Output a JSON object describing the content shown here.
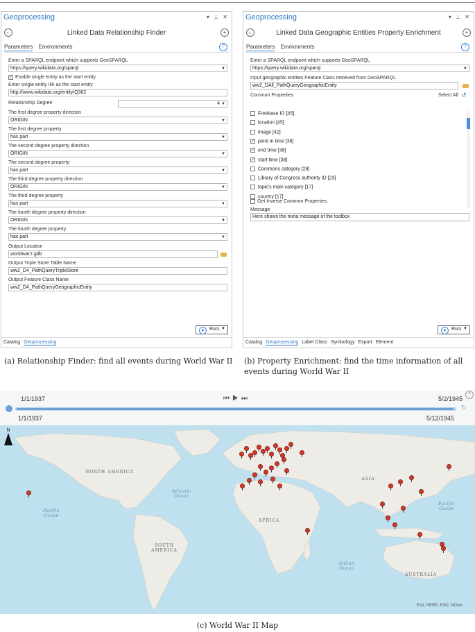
{
  "panelA": {
    "title": "Geoprocessing",
    "win_controls": "▾ ⊥ ✕",
    "tool_name": "Linked Data Relationship Finder",
    "tabs": {
      "parameters": "Parameters",
      "environments": "Environments"
    },
    "fields": {
      "endpoint_label": "Enter a SPARQL endpoint which supports GeoSPARQL",
      "endpoint_value": "https://query.wikidata.org/sparql",
      "enable_single_label": "Enable single entity as the start entity",
      "entity_iri_label": "Enter single entity IRI as the start entity",
      "entity_iri_value": "http://www.wikidata.org/entity/Q362",
      "degree_label": "Relationship Degree",
      "degree_value": "4",
      "d1_dir_label": "The first degree property direction",
      "d1_dir_value": "ORIGIN",
      "d1_prop_label": "The first degree property",
      "d1_prop_value": "has part",
      "d2_dir_label": "The second degree property direction",
      "d2_dir_value": "ORIGIN",
      "d2_prop_label": "The second degree property",
      "d2_prop_value": "has part",
      "d3_dir_label": "The third degree property direction",
      "d3_dir_value": "ORIGIN",
      "d3_prop_label": "The third degree property",
      "d3_prop_value": "has part",
      "d4_dir_label": "The fourth degree property direction",
      "d4_dir_value": "ORIGIN",
      "d4_prop_label": "The fourth degree property",
      "d4_prop_value": "has part",
      "out_loc_label": "Output Location",
      "out_loc_value": "worldwar2.gdb",
      "out_triple_label": "Output Triple Store Table Name",
      "out_triple_value": "ww2_D4_PathQueryTripleStore",
      "out_fc_label": "Output Feature Class Name",
      "out_fc_value": "ww2_D4_PathQueryGeographicEntity"
    },
    "run_label": "Run",
    "bottom_tabs": [
      "Catalog",
      "Geoprocessing"
    ]
  },
  "panelB": {
    "title": "Geoprocessing",
    "win_controls": "▾ ⊥ ✕",
    "tool_name": "Linked Data Geographic Entities Property Enrichment",
    "tabs": {
      "parameters": "Parameters",
      "environments": "Environments"
    },
    "fields": {
      "endpoint_label": "Enter a SPARQL endpoint which supports GeoSPARQL",
      "endpoint_value": "https://query.wikidata.org/sparql",
      "input_fc_label": "Input geographic entities Feature Class retrieved from GeoSPARQL",
      "input_fc_value": "ww2_DAll_PathQueryGeographicEntity",
      "common_label": "Common Properties",
      "select_all": "Select All",
      "inverse_label": "Get Inverse Common Properties",
      "message_label": "Message",
      "message_value": "Here shows the meta message of the toolbox"
    },
    "properties": [
      {
        "label": "Freebase ID [45]",
        "checked": false
      },
      {
        "label": "location [45]",
        "checked": false
      },
      {
        "label": "image [42]",
        "checked": false
      },
      {
        "label": "point in time [38]",
        "checked": true
      },
      {
        "label": "end time [38]",
        "checked": true
      },
      {
        "label": "start time [38]",
        "checked": true
      },
      {
        "label": "Commons category [28]",
        "checked": false
      },
      {
        "label": "Library of Congress authority ID [23]",
        "checked": false
      },
      {
        "label": "topic's main category [17]",
        "checked": false
      },
      {
        "label": "country [17]",
        "checked": false
      }
    ],
    "run_label": "Run",
    "bottom_tabs": [
      "Catalog",
      "Geoprocessing",
      "Label Class",
      "Symbology",
      "Export",
      "Element"
    ]
  },
  "captions": {
    "a": "(a) Relationship Finder: find all events during World War II",
    "b": "(b) Property Enrichment: find the time information of all events during World War II",
    "c": "(c) World War II Map"
  },
  "timeslider": {
    "start_top": "1/1/1937",
    "end_top": "5/2/1945",
    "start_bottom": "1/1/1937",
    "end_bottom": "5/12/1945"
  },
  "map": {
    "labels": {
      "north_america": "NORTH AMERICA",
      "south_america": "SOUTH AMERICA",
      "asia": "ASIA",
      "africa": "AFRICA",
      "australia": "AUSTRALIA",
      "atlantic": "Atlantic Ocean",
      "pacific_left": "Pacific Ocean",
      "pacific_right": "Pacific Ocean",
      "indian": "Indian Ocean"
    },
    "attribution": "Esri, HERE, FAO, NOAA",
    "north_arrow": "N"
  }
}
